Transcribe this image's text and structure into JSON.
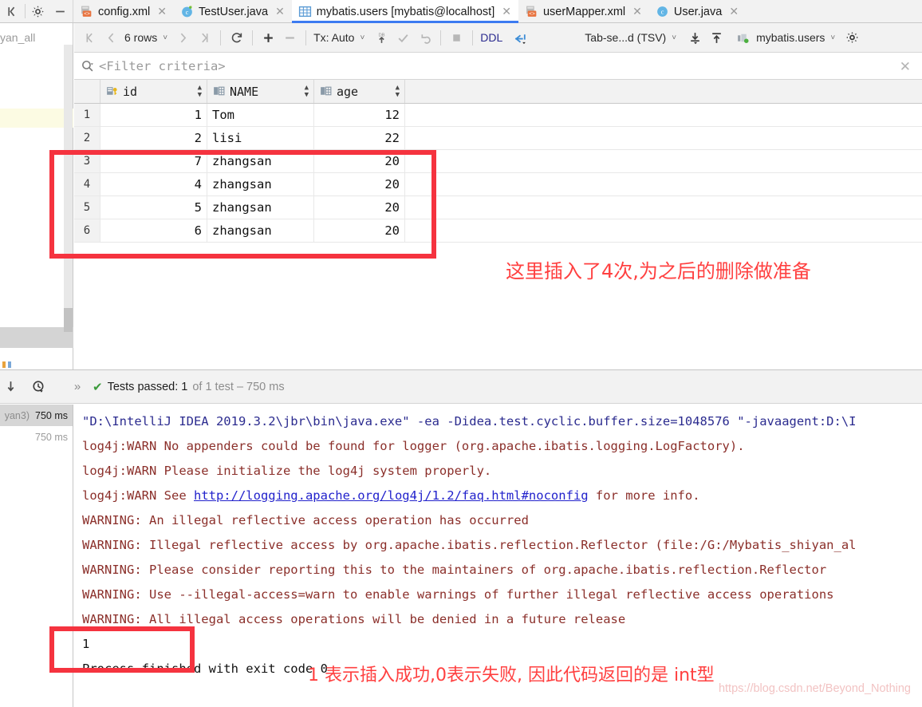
{
  "window": {
    "left_controls": [
      "collapse-icon",
      "gear-icon",
      "minimize-icon"
    ]
  },
  "tabs": [
    {
      "label": "config.xml",
      "icon": "xml-file-icon",
      "active": false,
      "closable": true
    },
    {
      "label": "TestUser.java",
      "icon": "java-class-icon",
      "active": false,
      "closable": true
    },
    {
      "label": "mybatis.users [mybatis@localhost]",
      "icon": "database-table-icon",
      "active": true,
      "closable": true
    },
    {
      "label": "userMapper.xml",
      "icon": "xml-file-icon",
      "active": false,
      "closable": true
    },
    {
      "label": "User.java",
      "icon": "java-class-icon",
      "active": false,
      "closable": true
    }
  ],
  "left_panel": {
    "truncated_label": "yan_all"
  },
  "db_toolbar": {
    "first_page": "|<",
    "prev_page": "<",
    "rows_label": "6 rows",
    "next_page": ">",
    "last_page": ">|",
    "reload_icon": "refresh-icon",
    "add_row_icon": "plus-icon",
    "delete_row_icon": "minus-icon",
    "tx_label": "Tx: Auto",
    "submit_icon": "db-upload-icon",
    "commit_icon": "check-icon",
    "rollback_icon": "revert-icon",
    "stop_icon": "stop-icon",
    "ddl_label": "DDL",
    "jump_icon": "goto-icon",
    "format_label": "Tab-se...d (TSV)",
    "import_icon": "download-icon",
    "export_icon": "upload-icon",
    "schema_icon": "db-schema-icon",
    "schema_label": "mybatis.users",
    "settings_icon": "gear-icon"
  },
  "filter": {
    "icon": "search-icon",
    "placeholder": "<Filter criteria>",
    "close_icon": "close-icon"
  },
  "table": {
    "columns": [
      {
        "name": "id",
        "icon": "primary-key-icon"
      },
      {
        "name": "NAME",
        "icon": "column-icon"
      },
      {
        "name": "age",
        "icon": "column-icon"
      }
    ],
    "rows": [
      {
        "no": "1",
        "id": "1",
        "NAME": "Tom",
        "age": "12"
      },
      {
        "no": "2",
        "id": "2",
        "NAME": "lisi",
        "age": "22"
      },
      {
        "no": "3",
        "id": "7",
        "NAME": "zhangsan",
        "age": "20"
      },
      {
        "no": "4",
        "id": "4",
        "NAME": "zhangsan",
        "age": "20"
      },
      {
        "no": "5",
        "id": "5",
        "NAME": "zhangsan",
        "age": "20"
      },
      {
        "no": "6",
        "id": "6",
        "NAME": "zhangsan",
        "age": "20"
      }
    ]
  },
  "annotations": {
    "grid_note": "这里插入了4次,为之后的删除做准备",
    "console_note": "1 表示插入成功,0表示失败, 因此代码返回的是 int型"
  },
  "run_panel": {
    "rerun_icon": "rerun-icon",
    "history_icon": "history-clock-icon",
    "expand_icon": "chevrons-right-icon",
    "status_icon": "check-green-icon",
    "status_label": "Tests passed: 1",
    "status_detail": "of 1 test – 750 ms",
    "tree": [
      {
        "name": "yan3)",
        "time": "750 ms",
        "selected": true
      },
      {
        "name": "",
        "time": "750 ms",
        "selected": false
      }
    ],
    "console_lines": [
      {
        "text": "\"D:\\IntelliJ IDEA 2019.3.2\\jbr\\bin\\java.exe\" -ea -Didea.test.cyclic.buffer.size=1048576 \"-javaagent:D:\\I",
        "color": "blue"
      },
      {
        "text": "log4j:WARN No appenders could be found for logger (org.apache.ibatis.logging.LogFactory).",
        "color": "red"
      },
      {
        "text": "log4j:WARN Please initialize the log4j system properly.",
        "color": "red"
      },
      {
        "text": "log4j:WARN See http://logging.apache.org/log4j/1.2/faq.html#noconfig for more info.",
        "color": "red",
        "link": "http://logging.apache.org/log4j/1.2/faq.html#noconfig"
      },
      {
        "text": "WARNING: An illegal reflective access operation has occurred",
        "color": "red"
      },
      {
        "text": "WARNING: Illegal reflective access by org.apache.ibatis.reflection.Reflector (file:/G:/Mybatis_shiyan_al",
        "color": "red"
      },
      {
        "text": "WARNING: Please consider reporting this to the maintainers of org.apache.ibatis.reflection.Reflector",
        "color": "red"
      },
      {
        "text": "WARNING: Use --illegal-access=warn to enable warnings of further illegal reflective access operations",
        "color": "red"
      },
      {
        "text": "WARNING: All illegal access operations will be denied in a future release",
        "color": "red"
      },
      {
        "text": "1",
        "color": "black"
      },
      {
        "text": "Process finished with exit code 0",
        "color": "black"
      }
    ]
  },
  "watermark": "https://blog.csdn.net/Beyond_Nothing",
  "colors": {
    "accent_blue": "#3c7bf1",
    "annotation_red": "#ff4040",
    "box_red": "#f5333f",
    "console_red": "#8b2f2a",
    "console_blue": "#2b2b8f"
  }
}
